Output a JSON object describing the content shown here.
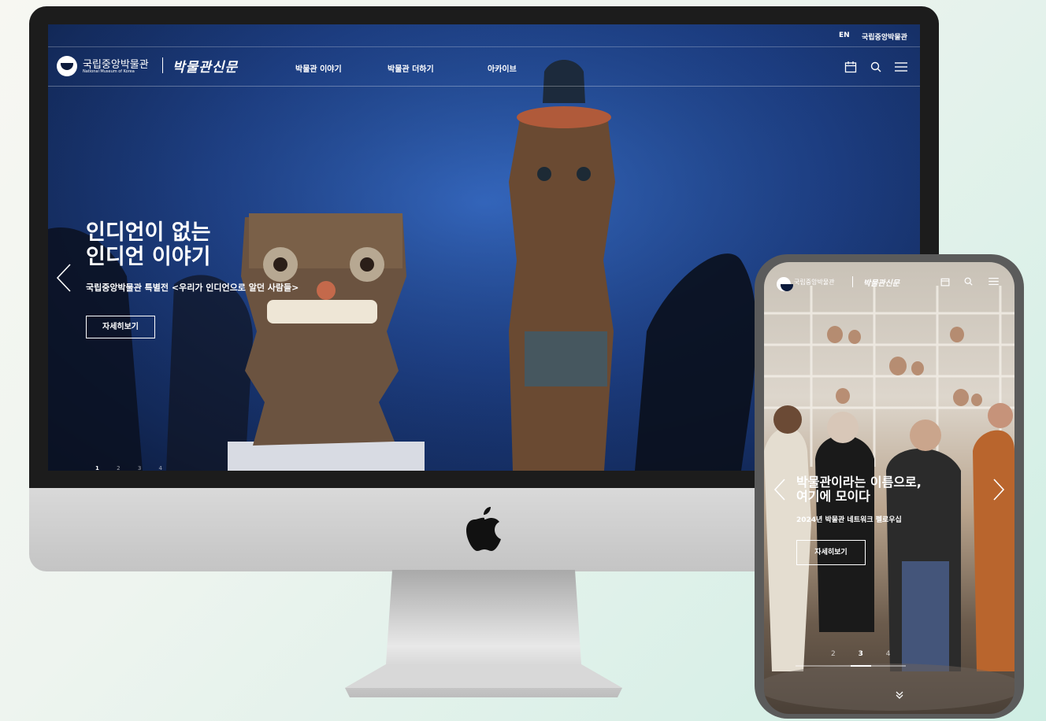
{
  "desktop": {
    "topbar": {
      "lang": "EN",
      "museum_link": "국립중앙박물관"
    },
    "logo": {
      "name": "국립중앙박물관",
      "english": "National Museum of Korea",
      "brand": "박물관신문"
    },
    "menu": [
      "박물관 이야기",
      "박물관 더하기",
      "아카이브"
    ],
    "icons": [
      "calendar-icon",
      "search-icon",
      "menu-icon"
    ],
    "hero": {
      "title_line1": "인디언이 없는",
      "title_line2": "인디언 이야기",
      "subtitle": "국립중앙박물관 특별전 <우리가 인디언으로 알던 사람들>",
      "button": "자세히보기",
      "pages": [
        "1",
        "2",
        "3",
        "4"
      ],
      "active_page": 1
    }
  },
  "mobile": {
    "logo": {
      "name": "국립중앙박물관",
      "brand": "박물관신문"
    },
    "hero": {
      "title_line1": "박물관이라는 이름으로,",
      "title_line2": "여기에 모이다",
      "subtitle": "2024년 박물관 네트워크 펠로우십",
      "button": "자세히보기",
      "pages": [
        "2",
        "3",
        "4"
      ],
      "active_page": 3
    }
  },
  "colors": {
    "accent": "#1d3f86",
    "white": "#ffffff"
  }
}
